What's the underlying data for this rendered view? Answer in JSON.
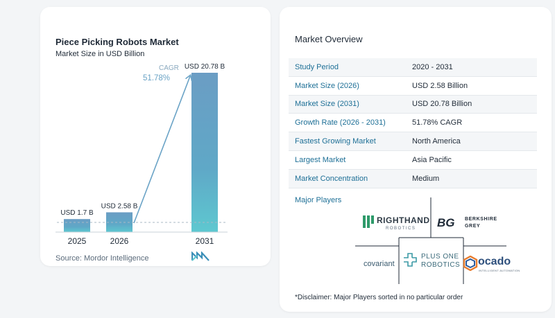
{
  "chart": {
    "title": "Piece Picking Robots Market",
    "subtitle": "Market Size in USD Billion",
    "source": "Source:  Mordor Intelligence",
    "cagr_label": "CAGR",
    "cagr_value": "51.78%"
  },
  "chart_data": {
    "type": "bar",
    "title": "Piece Picking Robots Market",
    "subtitle": "Market Size in USD Billion",
    "categories": [
      "2025",
      "2026",
      "2031"
    ],
    "values": [
      1.7,
      2.58,
      20.78
    ],
    "data_labels": [
      "USD 1.7 B",
      "USD 2.58 B",
      "USD 20.78 B"
    ],
    "unit": "USD Billion",
    "annotation": {
      "label": "CAGR",
      "value": "51.78%"
    },
    "colors": {
      "bar_top": "#7fb2cf",
      "bar_mid": "#5f9fc2",
      "bar_bottom": "#5ec8d0",
      "arrow": "#6aa3c6",
      "baseline": "#a9b8c4"
    }
  },
  "overview": {
    "title": "Market Overview",
    "rows": [
      {
        "label": "Study Period",
        "value": "2020 - 2031"
      },
      {
        "label": "Market Size (2026)",
        "value": "USD 2.58 Billion"
      },
      {
        "label": "Market Size (2031)",
        "value": "USD 20.78 Billion"
      },
      {
        "label": "Growth Rate (2026 - 2031)",
        "value": "51.78% CAGR"
      },
      {
        "label": "Fastest Growing Market",
        "value": "North America"
      },
      {
        "label": "Largest Market",
        "value": "Asia Pacific"
      },
      {
        "label": "Market Concentration",
        "value": "Medium"
      }
    ]
  },
  "players": {
    "title": "Major Players",
    "righthand": {
      "name": "RIGHTHAND",
      "sub": "ROBOTICS"
    },
    "berkshire": {
      "mark": "BG",
      "line1": "BERKSHIRE",
      "line2": "GREY"
    },
    "covariant": {
      "name": "covariant"
    },
    "plusone": {
      "line1": "PLUS ONE",
      "line2": "ROBOTICS"
    },
    "ocado": {
      "name": "ocado",
      "sub": "INTELLIGENT AUTOMATION"
    }
  },
  "disclaimer": "*Disclaimer: Major Players sorted in no particular order",
  "colors": {
    "accent": "#1d6f96",
    "label_blue": "#1d6f96",
    "card_bg": "#ffffff",
    "page_bg": "#f3f5f7"
  }
}
